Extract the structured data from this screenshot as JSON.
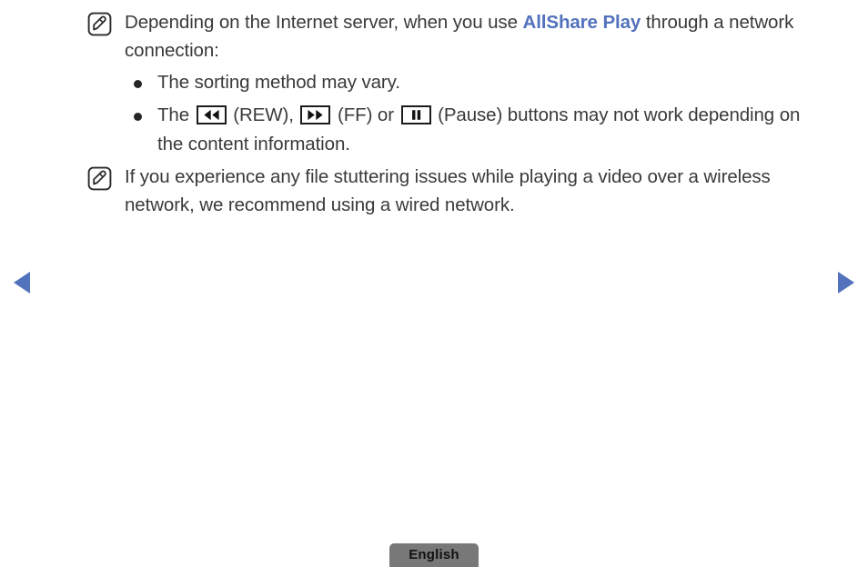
{
  "page": {
    "background": "#ffffff",
    "text_color": "#3a3a3a",
    "accent_color": "#5272bd",
    "button_color": "#787878"
  },
  "notes": [
    {
      "icon": "note-pen-icon",
      "text_before": "Depending on the Internet server, when you use ",
      "highlight": "AllShare Play",
      "text_after": " through a network connection:"
    },
    {
      "icon": "note-pen-icon",
      "text": "If you experience any file stuttering issues while playing a video over a wireless network, we recommend using a wired network."
    }
  ],
  "bullets": [
    {
      "text": "The sorting method may vary."
    },
    {
      "seg1": "The ",
      "icon1": "rewind-icon",
      "seg2": " (REW), ",
      "icon2": "fast-forward-icon",
      "seg3": " (FF) or ",
      "icon3": "pause-icon",
      "seg4": " (Pause) buttons may not work depending on the content information."
    }
  ],
  "navigation": {
    "prev_label": "previous-page",
    "prev_icon": "triangle-left-icon",
    "next_label": "next-page",
    "next_icon": "triangle-right-icon",
    "arrow_color": "#5272bd"
  },
  "footer": {
    "language_label": "English"
  }
}
